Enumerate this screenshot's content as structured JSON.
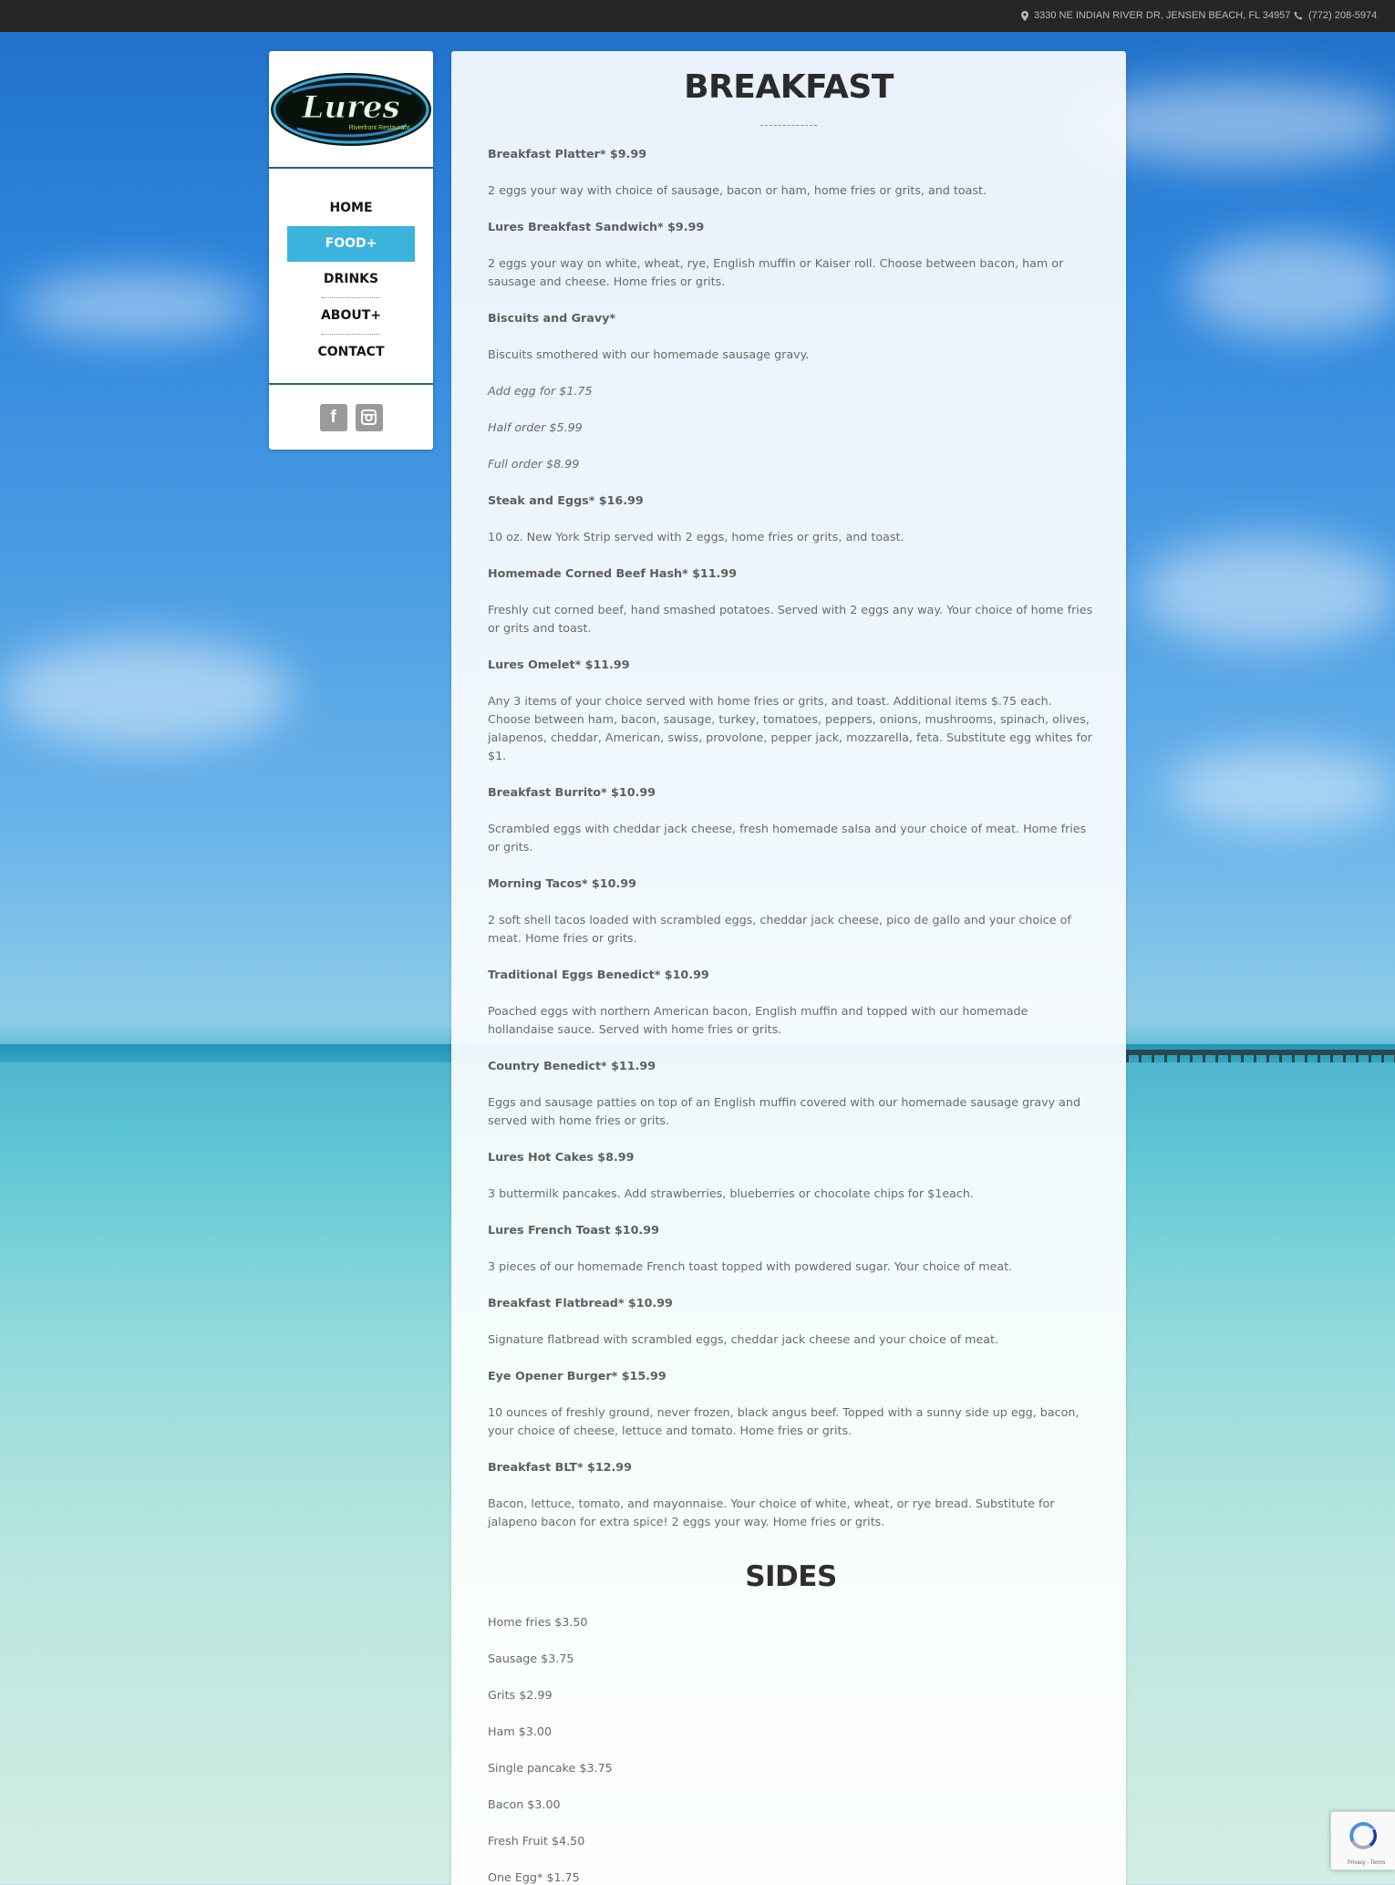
{
  "topbar": {
    "address": "3330 NE INDIAN RIVER DR, JENSEN BEACH, FL 34957",
    "phone": "(772) 208-5974"
  },
  "logo": {
    "name": "Lures",
    "tagline": "Riverfront Restaurant"
  },
  "nav": [
    {
      "label": "HOME"
    },
    {
      "label": "FOOD+"
    },
    {
      "label": "DRINKS"
    },
    {
      "label": "ABOUT+"
    },
    {
      "label": "CONTACT"
    }
  ],
  "social": {
    "facebook_label": "f",
    "icons": [
      "facebook-icon",
      "instagram-icon"
    ]
  },
  "page_title": "BREAKFAST",
  "items": [
    {
      "title": "Breakfast Platter* $9.99",
      "desc": "2 eggs your way with choice of sausage, bacon or ham, home fries or grits, and toast."
    },
    {
      "title": "Lures Breakfast Sandwich* $9.99",
      "desc": "2 eggs your way on white, wheat, rye, English muffin or Kaiser roll. Choose between bacon, ham or sausage and cheese. Home fries or grits."
    },
    {
      "title": "Biscuits and Gravy*",
      "desc": "Biscuits smothered with our homemade sausage gravy.",
      "options": [
        "Add egg for $1.75",
        "Half order $5.99",
        "Full order $8.99"
      ]
    },
    {
      "title": "Steak and Eggs* $16.99",
      "desc": "10 oz. New York Strip served with 2 eggs, home fries or grits, and toast."
    },
    {
      "title": "Homemade Corned Beef Hash* $11.99",
      "desc": "Freshly cut corned beef, hand smashed potatoes. Served with 2 eggs any way. Your choice of home fries or grits and toast."
    },
    {
      "title": "Lures Omelet* $11.99",
      "desc": "Any 3 items of your choice served with home fries or grits, and toast. Additional items $.75 each. Choose between ham, bacon, sausage, turkey, tomatoes, peppers, onions, mushrooms, spinach, olives, jalapenos, cheddar, American, swiss, provolone, pepper jack, mozzarella, feta. Substitute egg whites for $1."
    },
    {
      "title": "Breakfast Burrito* $10.99",
      "desc": "Scrambled eggs with cheddar jack cheese, fresh homemade salsa and your choice of meat. Home fries or grits."
    },
    {
      "title": "Morning Tacos* $10.99",
      "desc": "2 soft shell tacos loaded with scrambled eggs, cheddar jack cheese, pico de gallo and your choice of meat. Home fries or grits."
    },
    {
      "title": "Traditional Eggs Benedict* $10.99",
      "desc": "Poached eggs with northern American bacon, English muffin and topped with our homemade hollandaise sauce. Served with home fries or grits."
    },
    {
      "title": "Country Benedict* $11.99",
      "desc": "Eggs and sausage patties on top of an English muffin covered with our homemade sausage gravy and served with home fries or grits."
    },
    {
      "title": "Lures Hot Cakes $8.99",
      "desc": "3 buttermilk pancakes. Add strawberries, blueberries or chocolate chips for $1each."
    },
    {
      "title": "Lures French Toast $10.99",
      "desc": "3 pieces of our homemade French toast topped with powdered sugar. Your choice of meat."
    },
    {
      "title": "Breakfast Flatbread* $10.99",
      "desc": "Signature flatbread with scrambled eggs, cheddar jack cheese and your choice of meat."
    },
    {
      "title": "Eye Opener Burger* $15.99",
      "desc": "10 ounces of freshly ground, never frozen, black angus beef. Topped with a sunny side up egg, bacon, your choice of cheese, lettuce and tomato. Home fries or grits."
    },
    {
      "title": "Breakfast BLT* $12.99",
      "desc": "Bacon, lettuce, tomato, and mayonnaise. Your choice of white, wheat, or rye bread. Substitute for jalapeno bacon for extra spice! 2 eggs your way. Home fries or grits."
    }
  ],
  "sides_title": "SIDES",
  "sides": [
    "Home fries $3.50",
    "Sausage $3.75",
    "Grits $2.99",
    "Ham $3.00",
    "Single pancake $3.75",
    "Bacon $3.00",
    "Fresh Fruit $4.50",
    "One Egg* $1.75"
  ],
  "recaptcha": {
    "links": "Privacy - Terms"
  }
}
